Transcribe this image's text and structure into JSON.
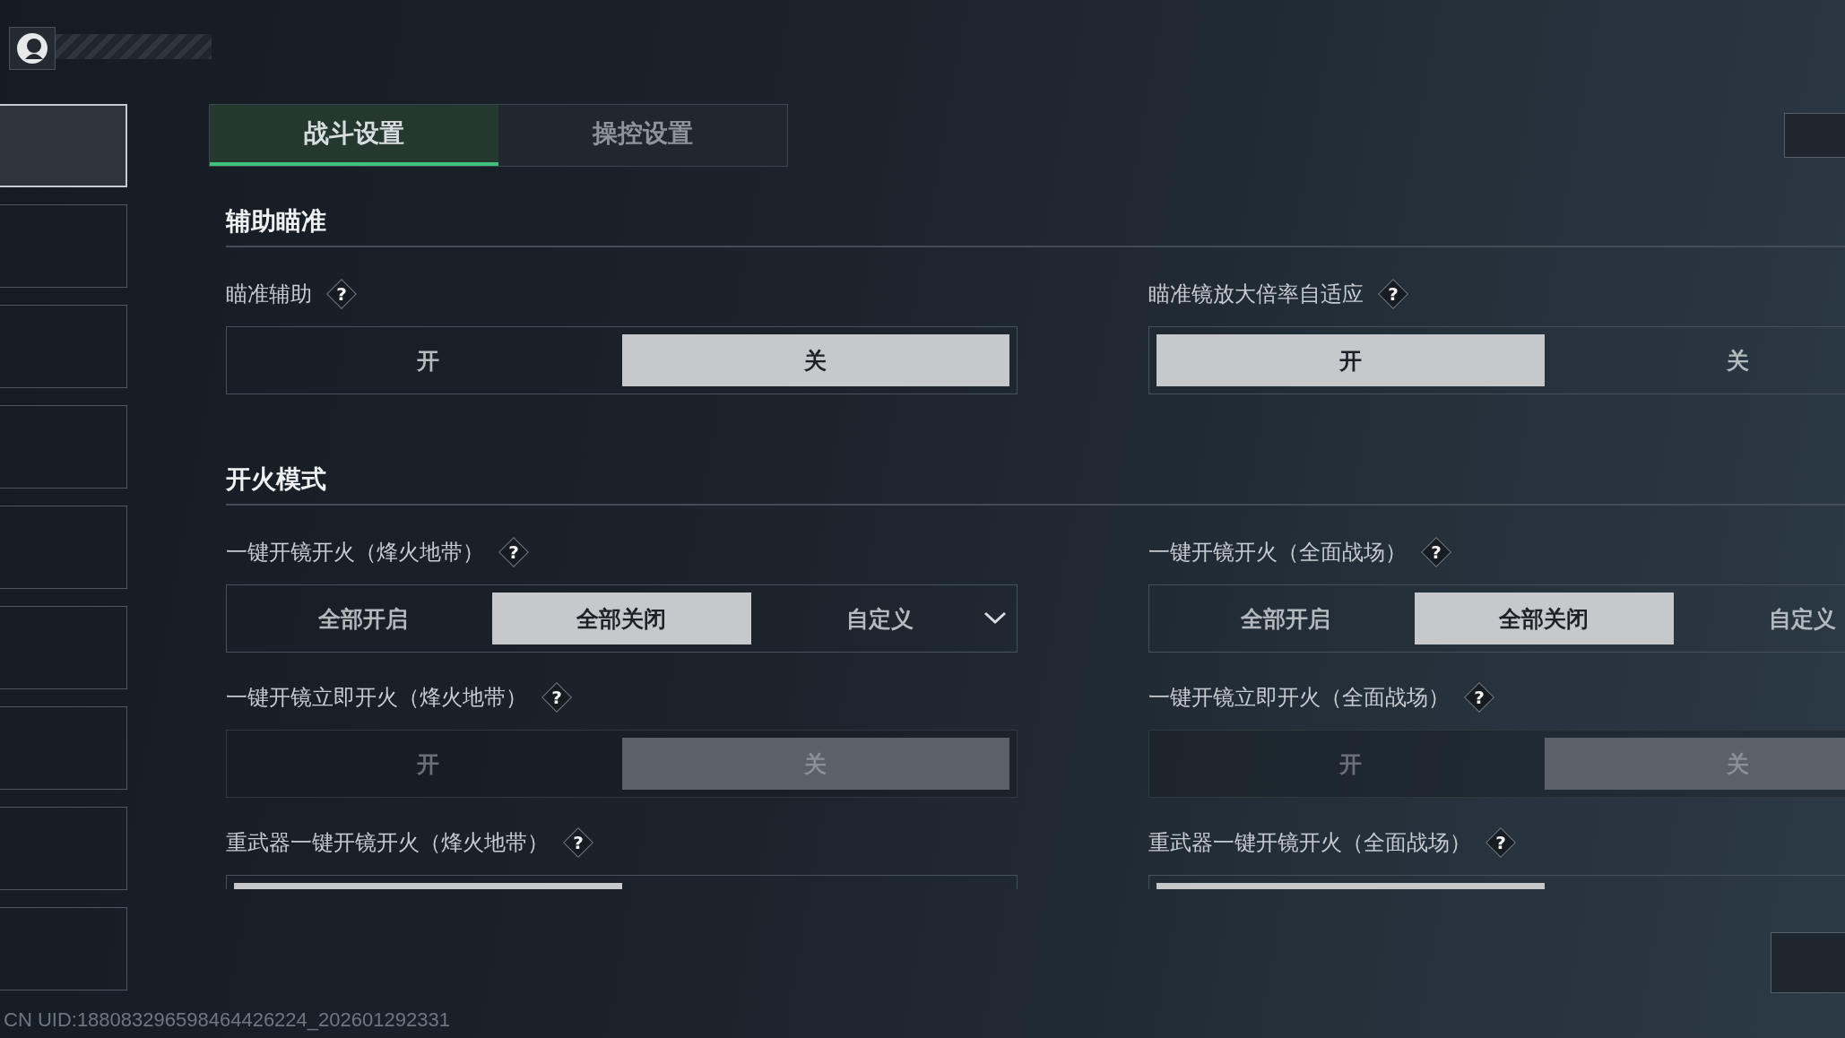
{
  "tabs": [
    {
      "label": "战斗设置",
      "selected": true
    },
    {
      "label": "操控设置",
      "selected": false
    }
  ],
  "sidebar": {
    "items": [
      {
        "selected": true
      },
      {
        "selected": false
      },
      {
        "selected": false
      },
      {
        "selected": false
      },
      {
        "selected": false
      },
      {
        "selected": false
      },
      {
        "selected": false
      },
      {
        "selected": false
      },
      {
        "selected": false
      }
    ]
  },
  "sections": [
    {
      "title": "辅助瞄准",
      "settings": [
        {
          "label": "瞄准辅助",
          "help": "?",
          "kind": "toggle",
          "disabled": false,
          "options": [
            {
              "label": "开",
              "selected": false
            },
            {
              "label": "关",
              "selected": true
            }
          ]
        },
        {
          "label": "瞄准镜放大倍率自适应",
          "help": "?",
          "kind": "toggle",
          "disabled": false,
          "options": [
            {
              "label": "开",
              "selected": true
            },
            {
              "label": "关",
              "selected": false
            }
          ]
        }
      ]
    },
    {
      "title": "开火模式",
      "settings": [
        {
          "label": "一键开镜开火（烽火地带）",
          "help": "?",
          "kind": "dropdown",
          "disabled": false,
          "options": [
            {
              "label": "全部开启",
              "selected": false
            },
            {
              "label": "全部关闭",
              "selected": true
            },
            {
              "label": "自定义",
              "selected": false
            }
          ]
        },
        {
          "label": "一键开镜开火（全面战场）",
          "help": "?",
          "kind": "dropdown",
          "disabled": false,
          "options": [
            {
              "label": "全部开启",
              "selected": false
            },
            {
              "label": "全部关闭",
              "selected": true
            },
            {
              "label": "自定义",
              "selected": false
            }
          ]
        },
        {
          "label": "一键开镜立即开火（烽火地带）",
          "help": "?",
          "kind": "toggle",
          "disabled": true,
          "options": [
            {
              "label": "开",
              "selected": false
            },
            {
              "label": "关",
              "selected": true
            }
          ]
        },
        {
          "label": "一键开镜立即开火（全面战场）",
          "help": "?",
          "kind": "toggle",
          "disabled": true,
          "options": [
            {
              "label": "开",
              "selected": false
            },
            {
              "label": "关",
              "selected": true
            }
          ]
        },
        {
          "label": "重武器一键开镜开火（烽火地带）",
          "help": "?",
          "kind": "toggle",
          "disabled": false,
          "options": [
            {
              "selected": true
            },
            {
              "selected": false
            }
          ]
        },
        {
          "label": "重武器一键开镜开火（全面战场）",
          "help": "?",
          "kind": "toggle",
          "disabled": false,
          "options": [
            {
              "selected": true
            },
            {
              "selected": false
            }
          ]
        }
      ]
    }
  ],
  "footer": {
    "uid": "CN UID:188083296598464426224_202601292331"
  }
}
